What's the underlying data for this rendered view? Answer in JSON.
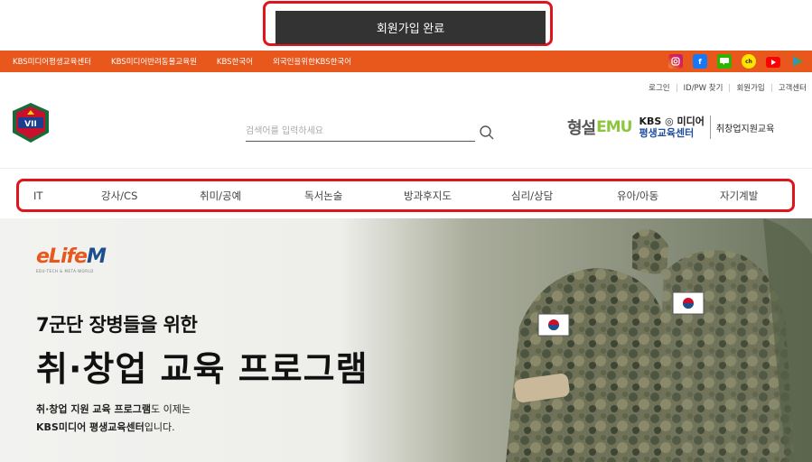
{
  "confirm": {
    "label": "회원가입 완료"
  },
  "topbar": {
    "links": [
      "KBS미디어평생교육센터",
      "KBS미디어반려동물교육원",
      "KBS한국어",
      "외국인을위한KBS한국어"
    ],
    "social": [
      {
        "name": "instagram-icon",
        "color": "#d6249f"
      },
      {
        "name": "facebook-icon",
        "color": "#1877f2",
        "glyph": "f"
      },
      {
        "name": "naver-blog-icon",
        "color": "#2db400"
      },
      {
        "name": "kakao-icon",
        "color": "#fee500"
      },
      {
        "name": "youtube-icon",
        "color": "#ff0000"
      },
      {
        "name": "play-icon",
        "color": "#34a853"
      }
    ]
  },
  "util": {
    "items": [
      "로그인",
      "ID/PW 찾기",
      "회원가입",
      "고객센터"
    ]
  },
  "search": {
    "placeholder": "검색어를 입력하세요"
  },
  "brand": {
    "hs": "형설",
    "emu": "EMU",
    "kbs_top": "KBS ◎ 미디어",
    "kbs_bot": "평생교육센터",
    "sub": "취창업지원교육"
  },
  "nav": {
    "items": [
      "IT",
      "강사/CS",
      "취미/공예",
      "독서논술",
      "방과후지도",
      "심리/상담",
      "유아/아동",
      "자기계발"
    ]
  },
  "hero": {
    "logo_e": "e",
    "logo_life": "Life",
    "logo_m": "M",
    "logo_sub": "EDU-TECH & META-WORLD",
    "line1": "7군단 장병들을 위한",
    "line2": "취·창업 교육 프로그램",
    "line3_bold": "취·창업 지원 교육 프로그램",
    "line3_rest": "도 이제는",
    "line4_bold": "KBS미디어 평생교육센터",
    "line4_rest": "입니다."
  },
  "colors": {
    "accent": "#e8571c",
    "highlight": "#e0141b",
    "dark_button": "#333333"
  }
}
